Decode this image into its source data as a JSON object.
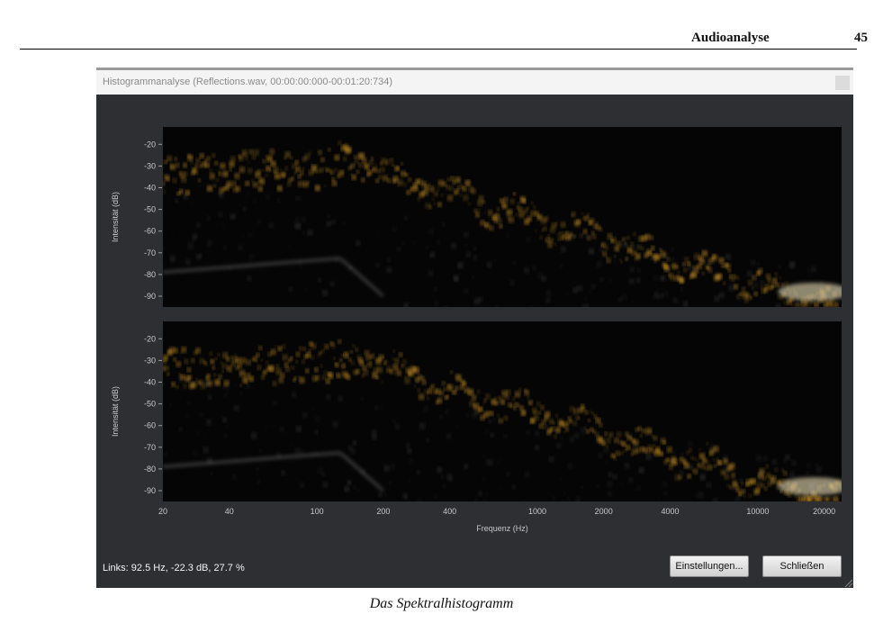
{
  "page_header": {
    "title": "Audioanalyse",
    "page_number": "45"
  },
  "window": {
    "title": "Histogrammanalyse (Reflections.wav, 00:00:00:000-00:01:20:734)",
    "status": "Links: 92.5 Hz, -22.3 dB, 27.7 %",
    "buttons": {
      "settings": "Einstellungen...",
      "close": "Schließen"
    }
  },
  "chart_data": [
    {
      "type": "heatmap",
      "channel": "top",
      "ylabel": "Intensität (dB)",
      "y_ticks": [
        -20,
        -30,
        -40,
        -50,
        -60,
        -70,
        -80,
        -90
      ],
      "ylim": [
        -95,
        -12
      ],
      "xscale": "log",
      "xlim": [
        20,
        24000
      ],
      "colors": {
        "background": "#050505",
        "density": "#e8a52a",
        "ghost": "#7c7c7c"
      }
    },
    {
      "type": "heatmap",
      "channel": "bottom",
      "ylabel": "Intensität (dB)",
      "xlabel": "Frequenz (Hz)",
      "x_ticks": [
        20,
        40,
        100,
        200,
        400,
        1000,
        2000,
        4000,
        10000,
        20000
      ],
      "y_ticks": [
        -20,
        -30,
        -40,
        -50,
        -60,
        -70,
        -80,
        -90
      ],
      "ylim": [
        -95,
        -12
      ],
      "xscale": "log",
      "xlim": [
        20,
        24000
      ],
      "colors": {
        "background": "#050505",
        "density": "#e8a52a",
        "ghost": "#7c7c7c"
      }
    }
  ],
  "caption": "Das Spektralhistogramm"
}
